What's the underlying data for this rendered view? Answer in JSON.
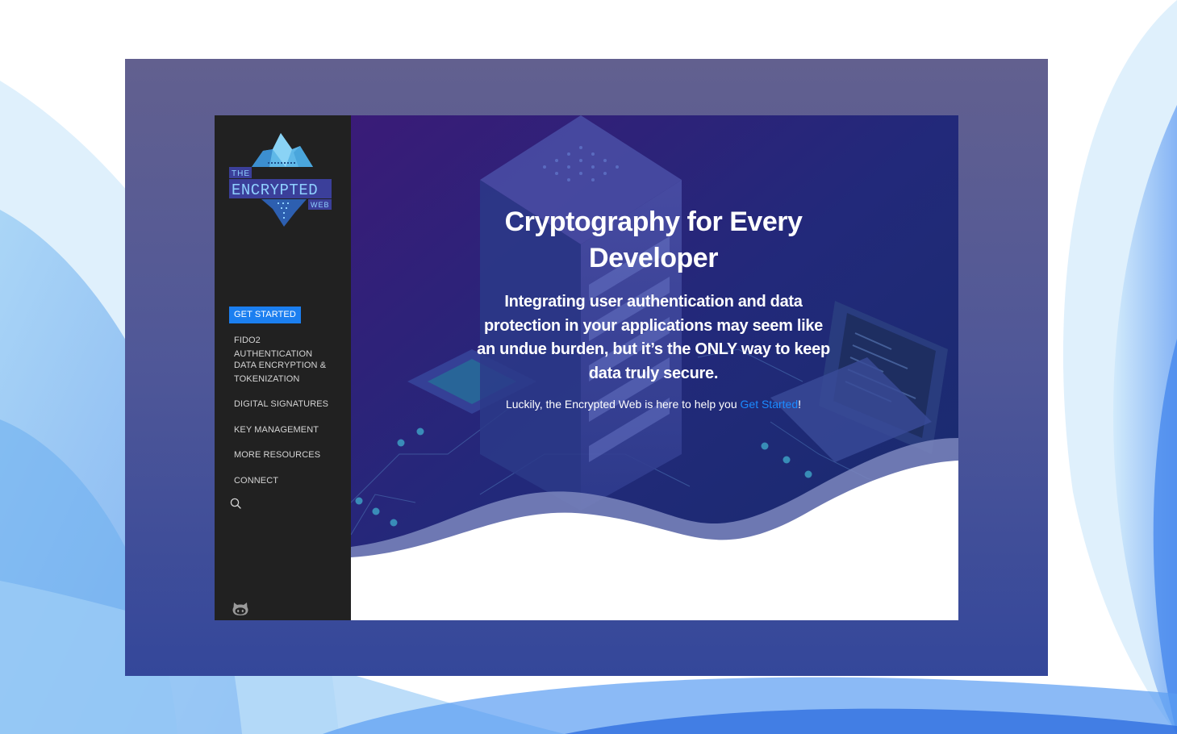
{
  "logo": {
    "line1": "THE",
    "line2": "ENCRYPTED",
    "line3": "WEB"
  },
  "nav": {
    "items": [
      {
        "label": "GET STARTED",
        "active": true
      },
      {
        "label": "FIDO2 AUTHENTICATION"
      },
      {
        "label_line1": "DATA ENCRYPTION &",
        "label_line2": "TOKENIZATION"
      },
      {
        "label": "DIGITAL SIGNATURES"
      },
      {
        "label": "KEY MANAGEMENT"
      },
      {
        "label": "MORE RESOURCES"
      },
      {
        "label": "CONNECT"
      }
    ],
    "search_icon": "search-icon",
    "github_icon": "github-icon"
  },
  "hero": {
    "title": "Cryptography for Every Developer",
    "subtitle": "Integrating user authentication and data protection in your applications may seem like an undue burden, but it’s the ONLY way to keep data truly secure.",
    "note_prefix": "Luckily, the Encrypted Web is here to help you ",
    "note_link": "Get Started",
    "note_suffix": "!"
  },
  "colors": {
    "accent": "#1b7ff0",
    "sidebar_bg": "#212121",
    "frame": "#4f5798",
    "hero_dark": "#2a1f6b"
  }
}
